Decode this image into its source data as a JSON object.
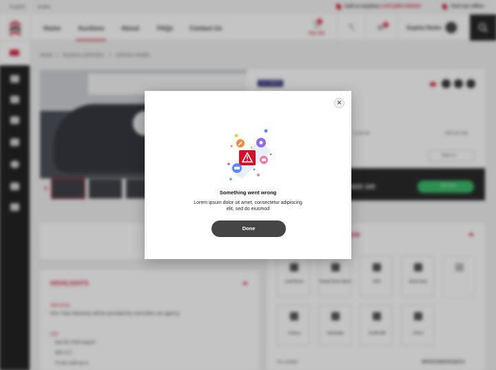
{
  "topbar": {
    "lang_english": "English",
    "lang_arabic": "Arabic",
    "call_label": "Call us anytime",
    "call_number": "(+971)800 545454",
    "office_label": "Visit our office"
  },
  "nav": {
    "items": [
      "Home",
      "Auctions",
      "About",
      "FAQs",
      "Contact Us"
    ],
    "active": "Auctions",
    "cart_badge": "1",
    "cart_timer": "04m 45s",
    "notif_badge": "1",
    "user_name": "Sophie Reiter"
  },
  "breadcrumb": [
    "Home",
    "Auctions (Vehicles)",
    "Vehicles Details"
  ],
  "vehicle": {
    "lot": "Lot # 183156",
    "mileage": "72,291 KM",
    "time_remaining": "1900 22H 29M",
    "notify": "Notify me",
    "highest_bid": "AED 100",
    "bid_button": "Bid Now"
  },
  "highlights": {
    "title": "HIGHLIGHTS",
    "warranty_label": "Warranty",
    "warranty_text": "One Year Warranty will be provided by mercedes car agency",
    "old_label": "Old",
    "bullets": [
      "Not for KSA export",
      "WO 4\"2",
      "To be sold as is"
    ]
  },
  "overview": {
    "title_suffix": "EW",
    "specs": [
      {
        "label": "Make",
        "value": "Land Rover"
      },
      {
        "label": "Model",
        "value": "Range Rover Sport"
      },
      {
        "label": "Year",
        "value": "2016"
      },
      {
        "label": "Keys",
        "value": "Smart keys"
      },
      {
        "label": "Doors",
        "value": "4 doors"
      },
      {
        "label": "Transmission",
        "value": "Automatic"
      },
      {
        "label": "Odometer",
        "value": "72,291 KM"
      },
      {
        "label": "Fuel Type",
        "value": "Petrol"
      }
    ],
    "vin_label": "Vin number",
    "vin_value": "WP0ZZZ99ZHS162313"
  },
  "modal": {
    "close_glyph": "✕",
    "title": "Something went wrong",
    "message": "Lorem ipsum dolor sit amet, consectetur adipiscing elit, sed do eiusmod",
    "done_label": "Done"
  },
  "colors": {
    "brand_red": "#d3102c",
    "done_button": "#454545",
    "bid_green": "#27b35b"
  }
}
